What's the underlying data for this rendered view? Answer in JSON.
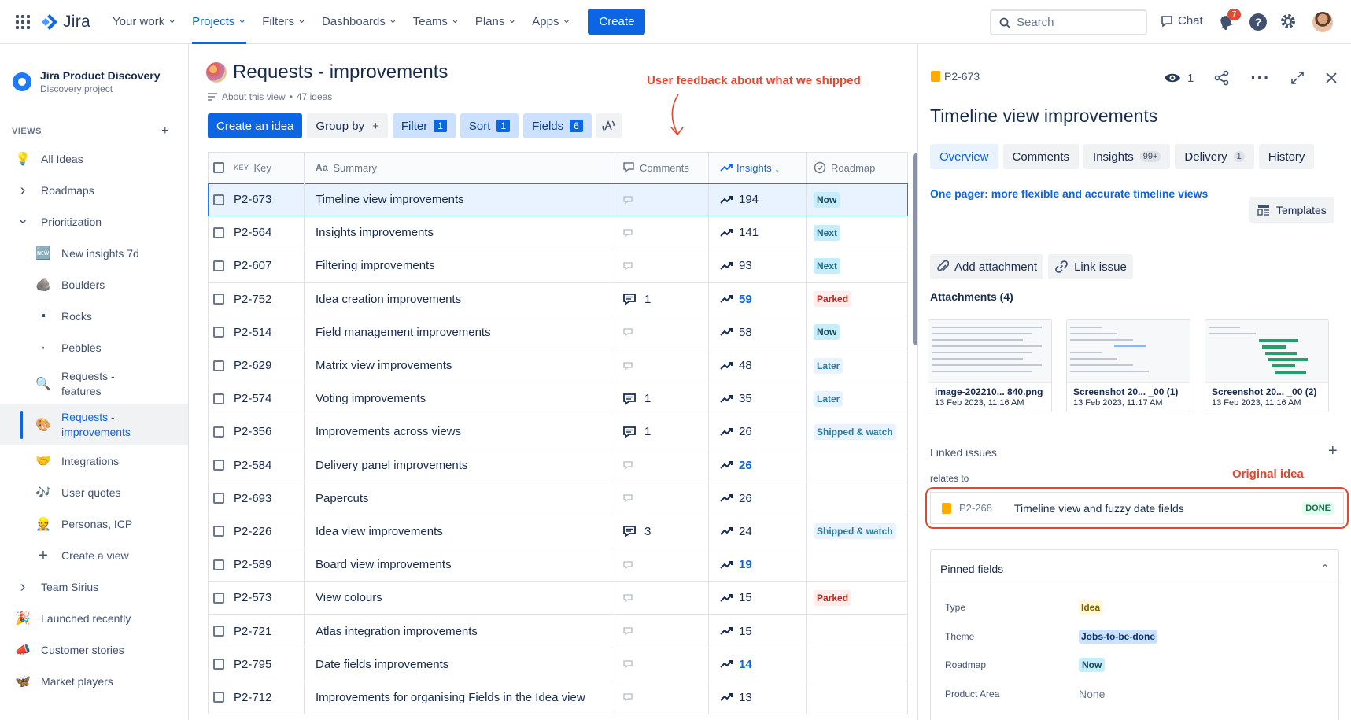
{
  "topnav": {
    "brand": "Jira",
    "items": [
      {
        "label": "Your work",
        "active": false
      },
      {
        "label": "Projects",
        "active": true
      },
      {
        "label": "Filters",
        "active": false
      },
      {
        "label": "Dashboards",
        "active": false
      },
      {
        "label": "Teams",
        "active": false
      },
      {
        "label": "Plans",
        "active": false
      },
      {
        "label": "Apps",
        "active": false
      }
    ],
    "create_label": "Create",
    "search_placeholder": "Search",
    "chat_label": "Chat",
    "notification_count": "7",
    "help_label": "?"
  },
  "sidebar": {
    "project_name": "Jira Product Discovery",
    "project_type": "Discovery project",
    "views_header": "VIEWS",
    "items": [
      {
        "label": "All Ideas",
        "icon": "lightbulb-icon",
        "glyph": "💡"
      },
      {
        "label": "Roadmaps",
        "icon": "chevron-right-icon",
        "glyph": "›"
      },
      {
        "label": "Prioritization",
        "icon": "chevron-down-icon",
        "glyph": "⌄"
      },
      {
        "label": "New insights 7d",
        "icon": "new-badge-icon",
        "glyph": "🆕"
      },
      {
        "label": "Boulders",
        "icon": "boulder-icon",
        "glyph": "🪨"
      },
      {
        "label": "Rocks",
        "icon": "rock-icon",
        "glyph": "▪"
      },
      {
        "label": "Pebbles",
        "icon": "pebble-icon",
        "glyph": "·"
      },
      {
        "label": "Requests - features",
        "icon": "search-map-icon",
        "glyph": "🔍"
      },
      {
        "label": "Requests - improvements",
        "icon": "palette-icon",
        "glyph": "🎨"
      },
      {
        "label": "Integrations",
        "icon": "handshake-icon",
        "glyph": "🤝"
      },
      {
        "label": "User quotes",
        "icon": "music-notes-icon",
        "glyph": "🎶"
      },
      {
        "label": "Personas, ICP",
        "icon": "person-icon",
        "glyph": "👷"
      },
      {
        "label": "Create a view",
        "icon": "plus-icon",
        "glyph": "+"
      },
      {
        "label": "Team Sirius",
        "icon": "chevron-right-icon",
        "glyph": "›"
      },
      {
        "label": "Launched recently",
        "icon": "party-popper-icon",
        "glyph": "🎉"
      },
      {
        "label": "Customer stories",
        "icon": "megaphone-icon",
        "glyph": "📣"
      },
      {
        "label": "Market players",
        "icon": "butterfly-icon",
        "glyph": "🦋"
      }
    ]
  },
  "main": {
    "title": "Requests - improvements",
    "about": "About this view",
    "ideas_count": "47 ideas",
    "annotation": "User feedback about what we shipped",
    "toolbar": {
      "create_idea": "Create an idea",
      "group_by": "Group by",
      "filter": "Filter",
      "filter_count": "1",
      "sort": "Sort",
      "sort_count": "1",
      "fields": "Fields",
      "fields_count": "6"
    },
    "columns": {
      "key_prefix": "KEY",
      "key": "Key",
      "summary_prefix": "Aa",
      "summary": "Summary",
      "comments": "Comments",
      "insights": "Insights ↓",
      "roadmap": "Roadmap"
    },
    "rows": [
      {
        "key": "P2-673",
        "summary": "Timeline view improvements",
        "comments": "",
        "insights": "194",
        "hi": false,
        "roadmap": "Now",
        "rm": "now"
      },
      {
        "key": "P2-564",
        "summary": "Insights improvements",
        "comments": "",
        "insights": "141",
        "hi": false,
        "roadmap": "Next",
        "rm": "next"
      },
      {
        "key": "P2-607",
        "summary": "Filtering improvements",
        "comments": "",
        "insights": "93",
        "hi": false,
        "roadmap": "Next",
        "rm": "next"
      },
      {
        "key": "P2-752",
        "summary": "Idea creation improvements",
        "comments": "1",
        "insights": "59",
        "hi": true,
        "roadmap": "Parked",
        "rm": "parked"
      },
      {
        "key": "P2-514",
        "summary": "Field management improvements",
        "comments": "",
        "insights": "58",
        "hi": false,
        "roadmap": "Now",
        "rm": "now"
      },
      {
        "key": "P2-629",
        "summary": "Matrix view improvements",
        "comments": "",
        "insights": "48",
        "hi": false,
        "roadmap": "Later",
        "rm": "later"
      },
      {
        "key": "P2-574",
        "summary": "Voting improvements",
        "comments": "1",
        "insights": "35",
        "hi": false,
        "roadmap": "Later",
        "rm": "later"
      },
      {
        "key": "P2-356",
        "summary": "Improvements across views",
        "comments": "1",
        "insights": "26",
        "hi": false,
        "roadmap": "Shipped & watch",
        "rm": "shipped"
      },
      {
        "key": "P2-584",
        "summary": "Delivery panel improvements",
        "comments": "",
        "insights": "26",
        "hi": true,
        "roadmap": "",
        "rm": ""
      },
      {
        "key": "P2-693",
        "summary": "Papercuts",
        "comments": "",
        "insights": "26",
        "hi": false,
        "roadmap": "",
        "rm": ""
      },
      {
        "key": "P2-226",
        "summary": "Idea view improvements",
        "comments": "3",
        "insights": "24",
        "hi": false,
        "roadmap": "Shipped & watch",
        "rm": "shipped"
      },
      {
        "key": "P2-589",
        "summary": "Board view improvements",
        "comments": "",
        "insights": "19",
        "hi": true,
        "roadmap": "",
        "rm": ""
      },
      {
        "key": "P2-573",
        "summary": "View colours",
        "comments": "",
        "insights": "15",
        "hi": false,
        "roadmap": "Parked",
        "rm": "parked"
      },
      {
        "key": "P2-721",
        "summary": "Atlas integration improvements",
        "comments": "",
        "insights": "15",
        "hi": false,
        "roadmap": "",
        "rm": ""
      },
      {
        "key": "P2-795",
        "summary": "Date fields improvements",
        "comments": "",
        "insights": "14",
        "hi": true,
        "roadmap": "",
        "rm": ""
      },
      {
        "key": "P2-712",
        "summary": "Improvements for organising Fields in the Idea view",
        "comments": "",
        "insights": "13",
        "hi": false,
        "roadmap": "",
        "rm": ""
      }
    ]
  },
  "panel": {
    "key": "P2-673",
    "watchers": "1",
    "title": "Timeline view improvements",
    "tabs": [
      {
        "label": "Overview",
        "badge": "",
        "active": true
      },
      {
        "label": "Comments",
        "badge": "",
        "active": false
      },
      {
        "label": "Insights",
        "badge": "99+",
        "active": false
      },
      {
        "label": "Delivery",
        "badge": "1",
        "active": false
      },
      {
        "label": "History",
        "badge": "",
        "active": false
      }
    ],
    "one_pager": "One pager: more flexible and accurate timeline views",
    "templates": "Templates",
    "add_attachment": "Add attachment",
    "link_issue": "Link issue",
    "attachments_header": "Attachments (4)",
    "attachments": [
      {
        "name": "image-202210... 840.png",
        "date": "13 Feb 2023, 11:16 AM"
      },
      {
        "name": "Screenshot 20... _00 (1)",
        "date": "13 Feb 2023, 11:17 AM"
      },
      {
        "name": "Screenshot 20... _00 (2)",
        "date": "13 Feb 2023, 11:16 AM"
      }
    ],
    "linked_issues": "Linked issues",
    "relates_to": "relates to",
    "original_idea_annotation": "Original idea",
    "linked": {
      "key": "P2-268",
      "title": "Timeline view and fuzzy date fields",
      "status": "DONE"
    },
    "pinned_fields": "Pinned fields",
    "fields": [
      {
        "label": "Type",
        "value": "Idea",
        "style": "idea"
      },
      {
        "label": "Theme",
        "value": "Jobs-to-be-done",
        "style": "jtbd"
      },
      {
        "label": "Roadmap",
        "value": "Now",
        "style": "now"
      },
      {
        "label": "Product Area",
        "value": "None",
        "style": "none"
      }
    ]
  }
}
